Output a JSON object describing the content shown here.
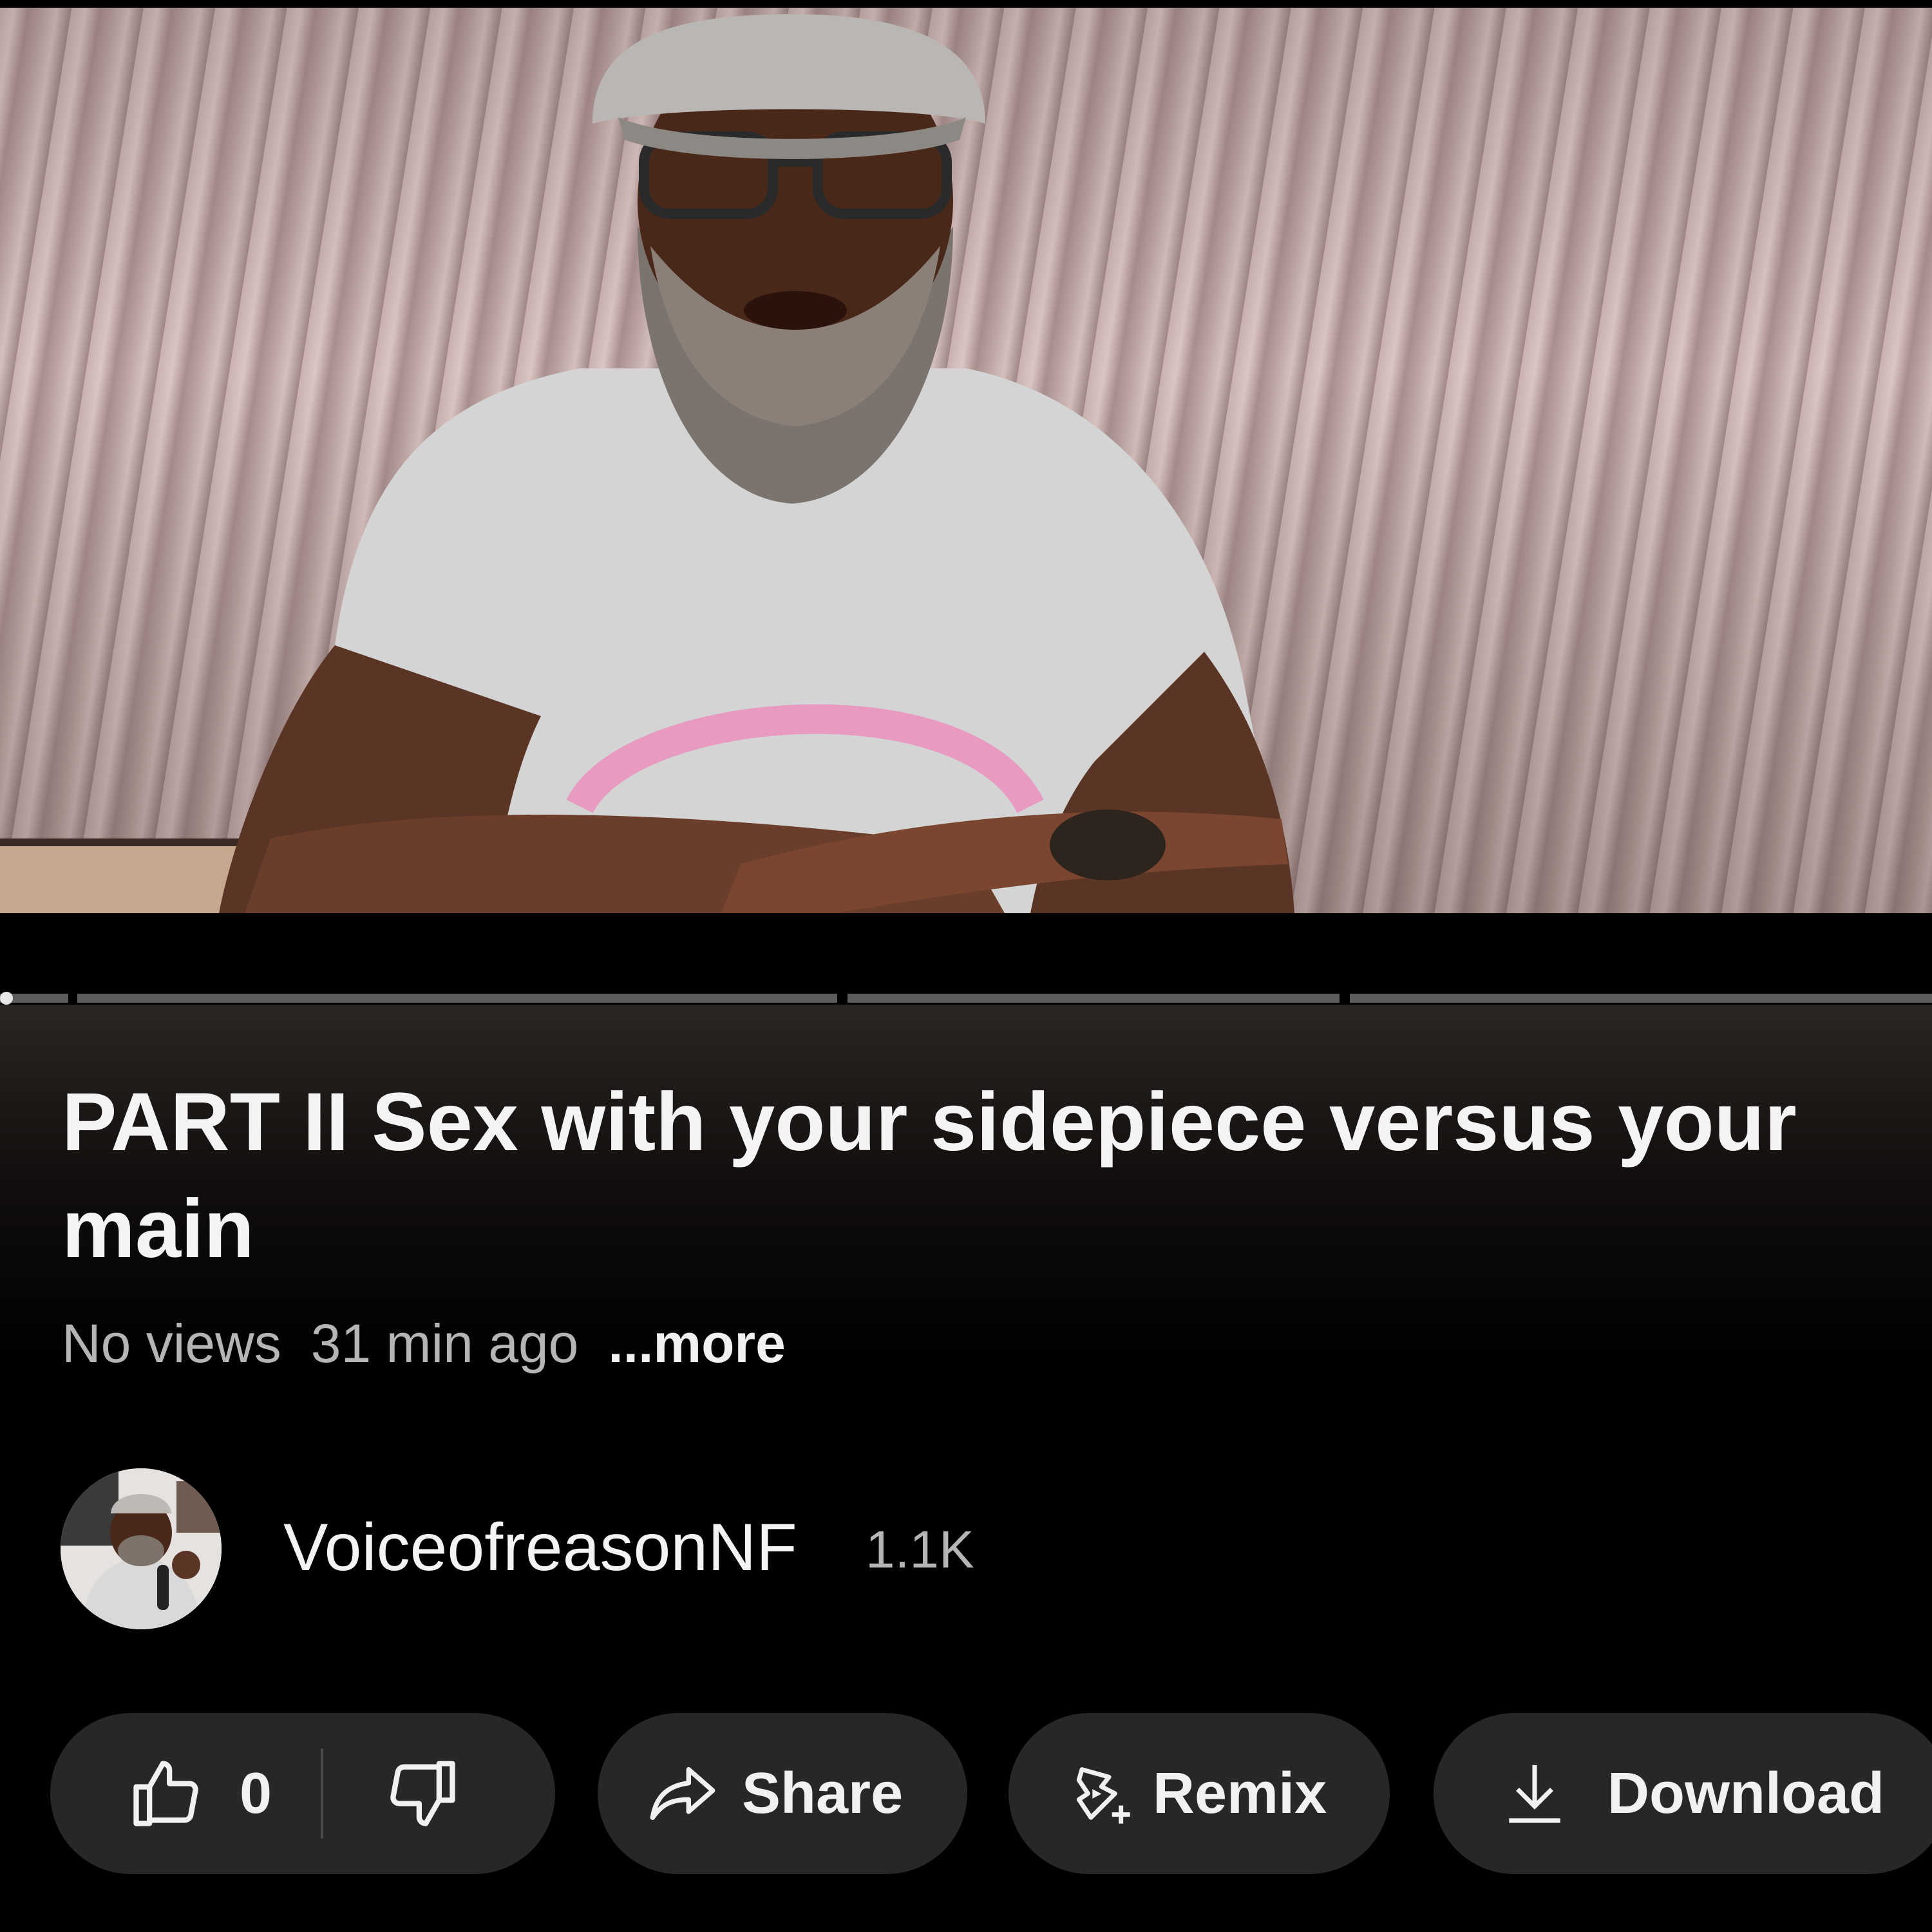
{
  "video": {
    "title": "PART II Sex with your sidepiece versus your main",
    "views": "No views",
    "age": "31 min ago",
    "more_label": "...more",
    "progress_fraction": 0.0,
    "chapter_count": 4
  },
  "channel": {
    "name": "VoiceofreasonNF",
    "subscribers": "1.1K"
  },
  "actions": {
    "like_count": "0",
    "share_label": "Share",
    "remix_label": "Remix",
    "download_label": "Download"
  },
  "icons": {
    "like": "thumbs-up-icon",
    "dislike": "thumbs-down-icon",
    "share": "share-arrow-icon",
    "remix": "remix-icon",
    "download": "download-icon"
  },
  "colors": {
    "background": "#000000",
    "pill": "#272727",
    "text_primary": "#f1f1f1",
    "text_secondary": "#b5b5b5",
    "progress_track": "#5c5c5c"
  }
}
